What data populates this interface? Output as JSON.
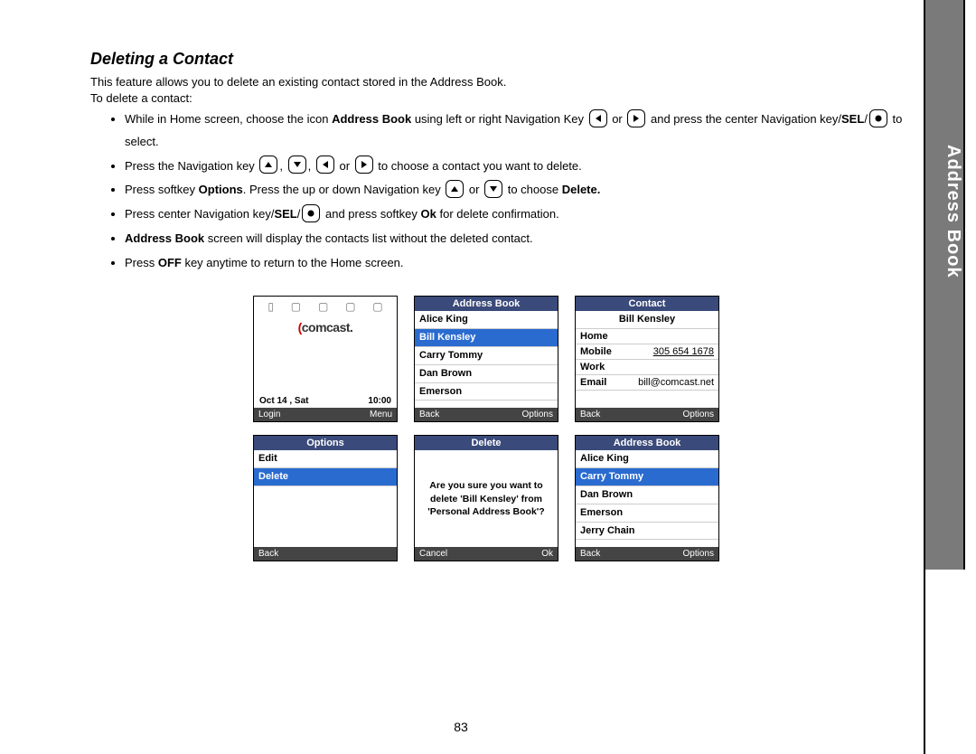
{
  "heading": "Deleting a Contact",
  "intro_line1": "This feature allows you to delete an existing contact stored in the Address Book.",
  "intro_line2": "To delete a contact:",
  "steps": {
    "s1a": "While in Home screen, choose the icon ",
    "s1b": "Address Book",
    "s1c": " using left or right Navigation Key ",
    "s1d": " or ",
    "s1e": " and press the center Navigation key/",
    "s1f": "SEL",
    "s1g": "/",
    "s1h": " to select.",
    "s2a": "Press the Navigation key ",
    "s2comma": ", ",
    "s2or": " or ",
    "s2b": " to choose a contact you want to delete.",
    "s3a": "Press softkey ",
    "s3b": "Options",
    "s3c": ". Press the up or down Navigation key ",
    "s3d": " or ",
    "s3e": " to choose ",
    "s3f": "Delete.",
    "s4a": "Press center Navigation key/",
    "s4b": "SEL",
    "s4c": "/",
    "s4d": " and press softkey ",
    "s4e": "Ok",
    "s4f": " for delete confirmation.",
    "s5a": "Address Book",
    "s5b": " screen will display the contacts list without the deleted contact.",
    "s6a": "Press ",
    "s6b": "OFF",
    "s6c": " key anytime to return to the Home screen."
  },
  "screens": {
    "home": {
      "logo": "comcast.",
      "date": "Oct 14 , Sat",
      "time": "10:00",
      "left": "Login",
      "right": "Menu"
    },
    "book1": {
      "title": "Address Book",
      "items": [
        "Alice King",
        "Bill Kensley",
        "Carry Tommy",
        "Dan Brown",
        "Emerson"
      ],
      "selected": 1,
      "left": "Back",
      "right": "Options"
    },
    "contact": {
      "title": "Contact",
      "name": "Bill Kensley",
      "fields": [
        {
          "label": "Home",
          "value": "",
          "selected": true
        },
        {
          "label": "Mobile",
          "value": "305 654 1678"
        },
        {
          "label": "Work",
          "value": ""
        },
        {
          "label": "Email",
          "value": "bill@comcast.net"
        }
      ],
      "left": "Back",
      "right": "Options"
    },
    "options": {
      "title": "Options",
      "items": [
        "Edit",
        "Delete"
      ],
      "selected": 1,
      "left": "Back",
      "right": ""
    },
    "delete": {
      "title": "Delete",
      "text": "Are you sure you want to delete 'Bill Kensley' from 'Personal Address Book'?",
      "left": "Cancel",
      "right": "Ok"
    },
    "book2": {
      "title": "Address Book",
      "items": [
        "Alice King",
        "Carry Tommy",
        "Dan Brown",
        "Emerson",
        "Jerry Chain"
      ],
      "selected": 1,
      "left": "Back",
      "right": "Options"
    }
  },
  "side_tab": "Address Book",
  "page_number": "83"
}
